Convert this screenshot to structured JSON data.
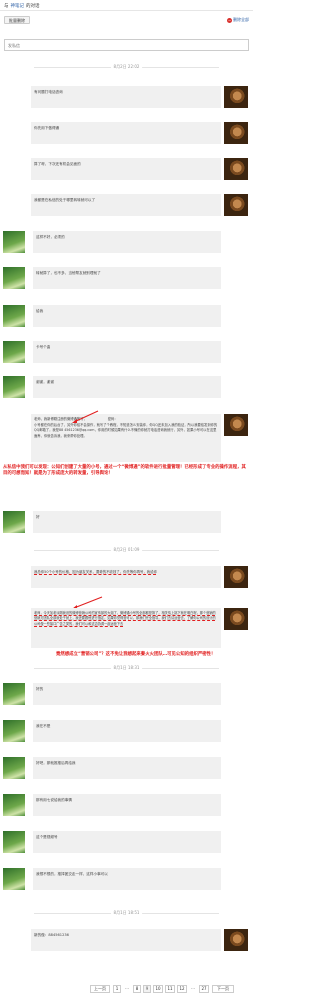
{
  "header": {
    "prefix": "与",
    "contact": "神笔记",
    "suffix": "的对话"
  },
  "toolbar": {
    "batch_delete": "批量删除",
    "delete_all": "删除全部",
    "delete_all_icon": "minus-circle-icon"
  },
  "send": {
    "placeholder": "发私信"
  },
  "times": {
    "t1": "8月2日 22:02",
    "t2": "8月2日 01:09",
    "t3": "8月1日 18:31",
    "t4": "8月1日 18:51"
  },
  "messages": {
    "m1": "有问题打电话咨询",
    "m2": "你先用下做得通",
    "m3": "算了呀，下次还有机会见面的",
    "m4": "我都是在私信的处于哪里转转就可以了",
    "m5": "这样不好，必须的",
    "m6": "转就算了，也不多，当他帮友就别理就了",
    "m7": "给我",
    "m8": "卡号个曲",
    "m9": "谢谢，谢谢",
    "m10": "老师，我新博刚注册的微博通账号，                    密码：\n小号都在你的后台了，另外你给不会操作，就写了个教程，不知道怎么安装你，你QQ还未加入我的验证，所以我要给发到你的QQ邮箱了，我是88 4561236@qq.com，你用的时候如果有什么不懂的你就打电话咨询我就行，另外，如果小号可以在这里面养，你就告诉我，我来帮你处理。",
    "m11": "好",
    "m12": "我总你50个小号的价格，因为朋友关系，要奇的不收钱了，你先等你再号，我给你",
    "m13": "老师，今天加老派刚我设的微博营销公司的宣传部的大姐了，微博通小号的全部都是搞了，相关情上挑下就在明白呢，那个营销的营销方团队全部就处于就上，我还要跟他进行指定，如果你觉得营可以，那我们完全指导，我们去请运营去，了解你公司的设计的公司做一些接口广告之类的，我们可以和这边协调一起运营下去",
    "m14": "好的",
    "m15": "我在不是",
    "m16": "好吧，那就推推后再给我",
    "m17": "那有用七说给我的事情",
    "m18": "这个是视频号",
    "m19": "我想不想的，推择团交走一样，这样小事可以",
    "m20": "新的做：884561236"
  },
  "annotations": {
    "a1": "从私信中我们可以发现：公知们创建了大量的小号，通过一个“微博通”的软件进行批量管理！已经形成了专业的操作流程，其目的可想而知！就是为了形成庞大的转发量，引导舆论！",
    "a2": "竟然想成立“营销公司”？这不免让我想起来秦火火团队…可见公知的组织严密性！"
  },
  "pager": {
    "prev": "上一页",
    "p1": "1",
    "dots": "...",
    "p8": "8",
    "p9": "9",
    "p10": "10",
    "p11": "11",
    "p12": "12",
    "p27": "27",
    "next": "下一页"
  },
  "colors": {
    "annotation": "#e11f1f",
    "link": "#2a5ea5",
    "bubble": "#f0f0f0"
  }
}
